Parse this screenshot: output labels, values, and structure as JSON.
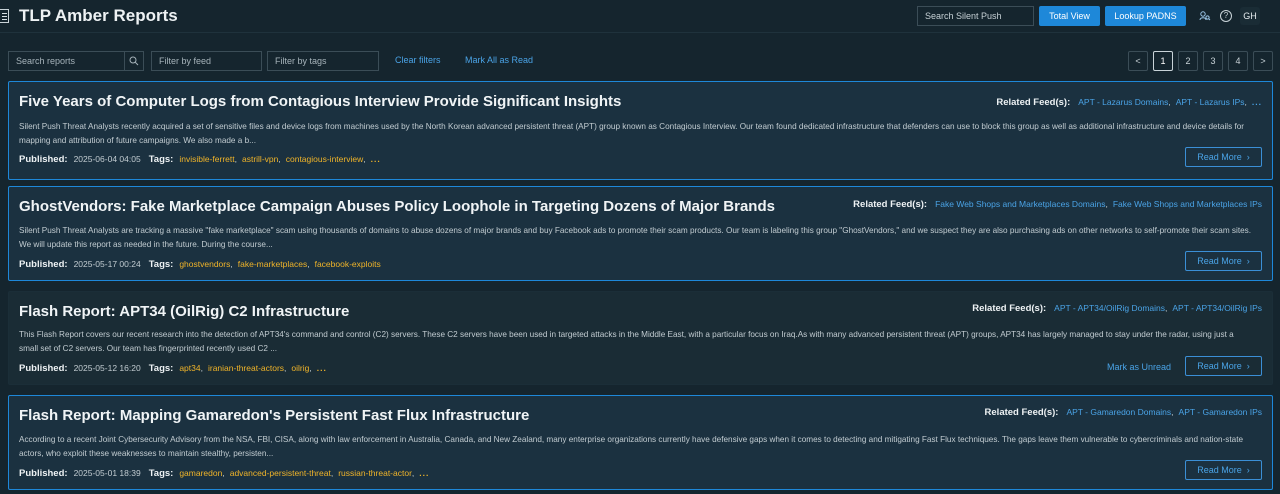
{
  "header": {
    "title": "TLP Amber Reports",
    "search_placeholder": "Search Silent Push",
    "total_view_label": "Total View",
    "lookup_label": "Lookup PADNS",
    "avatar_initials": "GH"
  },
  "filters": {
    "search_reports_placeholder": "Search reports",
    "feed_placeholder": "Filter by feed",
    "tags_placeholder": "Filter by tags",
    "clear_label": "Clear filters",
    "mark_all_label": "Mark All as Read"
  },
  "pagination": {
    "prev": "<",
    "next": ">",
    "pages": [
      "1",
      "2",
      "3",
      "4"
    ],
    "current": "1"
  },
  "labels": {
    "published": "Published:",
    "tags": "Tags:",
    "related_feeds": "Related Feed(s):",
    "read_more": "Read More",
    "mark_unread": "Mark as Unread",
    "ellipsis": "..."
  },
  "reports": [
    {
      "title": "Five Years of Computer Logs from Contagious Interview Provide Significant Insights",
      "description": "Silent Push Threat Analysts recently acquired a set of sensitive files and device logs from machines used by the North Korean advanced persistent threat (APT) group known as Contagious Interview. Our team found dedicated infrastructure that defenders can use to block this group as well as additional infrastructure and device details for mapping and attribution of future campaigns. We also made a b...",
      "published": "2025-06-04 04:05",
      "tags": [
        "invisible-ferrett",
        "astrill-vpn",
        "contagious-interview"
      ],
      "tags_more": true,
      "feeds": [
        "APT - Lazarus Domains",
        "APT - Lazarus IPs"
      ],
      "feeds_more": true,
      "unread": true
    },
    {
      "title": "GhostVendors: Fake Marketplace Campaign Abuses Policy Loophole in Targeting Dozens of Major Brands",
      "description": "Silent Push Threat Analysts are tracking a massive \"fake marketplace\" scam using thousands of domains to abuse dozens of major brands and buy Facebook ads to promote their scam products. Our team is labeling this group \"GhostVendors,\" and we suspect they are also purchasing ads on other networks to self-promote their scam sites. We will update this report as needed in the future. During the course...",
      "published": "2025-05-17 00:24",
      "tags": [
        "ghostvendors",
        "fake-marketplaces",
        "facebook-exploits"
      ],
      "tags_more": false,
      "feeds": [
        "Fake Web Shops and Marketplaces Domains",
        "Fake Web Shops and Marketplaces IPs"
      ],
      "feeds_more": false,
      "unread": true
    },
    {
      "title": "Flash Report: APT34 (OilRig) C2 Infrastructure",
      "description": "This Flash Report covers our recent research into the detection of APT34's command and control (C2) servers. These C2 servers have been used in targeted attacks in the Middle East, with a particular focus on Iraq.As with many advanced persistent threat (APT) groups, APT34 has largely managed to stay under the radar, using just a small set of C2 servers. Our team has fingerprinted recently used C2 ...",
      "published": "2025-05-12 16:20",
      "tags": [
        "apt34",
        "iranian-threat-actors",
        "oilrig"
      ],
      "tags_more": true,
      "feeds": [
        "APT - APT34/OilRig Domains",
        "APT - APT34/OilRig IPs"
      ],
      "feeds_more": false,
      "unread": false
    },
    {
      "title": "Flash Report: Mapping Gamaredon's Persistent Fast Flux Infrastructure",
      "description": "According to a recent Joint Cybersecurity Advisory from the NSA, FBI, CISA, along with law enforcement in Australia, Canada, and New Zealand, many enterprise organizations currently have defensive gaps when it comes to detecting and mitigating Fast Flux techniques. The gaps leave them vulnerable to cybercriminals and nation-state actors, who exploit these weaknesses to maintain stealthy, persisten...",
      "published": "2025-05-01 18:39",
      "tags": [
        "gamaredon",
        "advanced-persistent-threat",
        "russian-threat-actor"
      ],
      "tags_more": true,
      "feeds": [
        "APT - Gamaredon Domains",
        "APT - Gamaredon IPs"
      ],
      "feeds_more": false,
      "unread": true
    }
  ]
}
